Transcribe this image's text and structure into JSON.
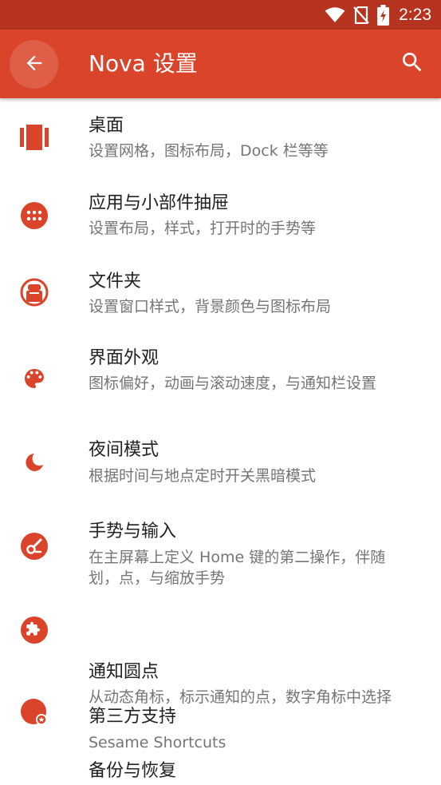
{
  "status_bar": {
    "time": "2:23",
    "icons": [
      "wifi-icon",
      "no-sim-icon",
      "battery-charging-icon"
    ]
  },
  "app_bar": {
    "title": "Nova 设置",
    "back_icon": "arrow-left-icon",
    "search_icon": "search-icon"
  },
  "accent_color": "#d9442a",
  "status_bar_color": "#b6341f",
  "settings": {
    "items": [
      {
        "icon": "desktop-icon",
        "title": "桌面",
        "subtitle": "设置网格，图标布局，Dock 栏等等"
      },
      {
        "icon": "app-drawer-icon",
        "title": "应用与小部件抽屉",
        "subtitle": "设置布局，样式，打开时的手势等"
      },
      {
        "icon": "folder-icon",
        "title": "文件夹",
        "subtitle": "设置窗口样式，背景颜色与图标布局"
      },
      {
        "icon": "palette-icon",
        "title": "界面外观",
        "subtitle": "图标偏好，动画与滚动速度，与通知栏设置"
      },
      {
        "icon": "moon-icon",
        "title": "夜间模式",
        "subtitle": "根据时间与地点定时开关黑暗模式"
      },
      {
        "icon": "gesture-icon",
        "title": "手势与输入",
        "subtitle": "在主屏幕上定义 Home 键的第二操作，伴随划，点，与缩放手势"
      },
      {
        "icon": "puzzle-icon",
        "title": "第三方支持",
        "subtitle": "Sesame Shortcuts"
      },
      {
        "icon": "notification-badge-icon",
        "title": "通知圆点",
        "subtitle": "从动态角标，标示通知的点，数字角标中选择"
      },
      {
        "icon": "backup-icon",
        "title": "备份与恢复",
        "subtitle": ""
      }
    ]
  }
}
